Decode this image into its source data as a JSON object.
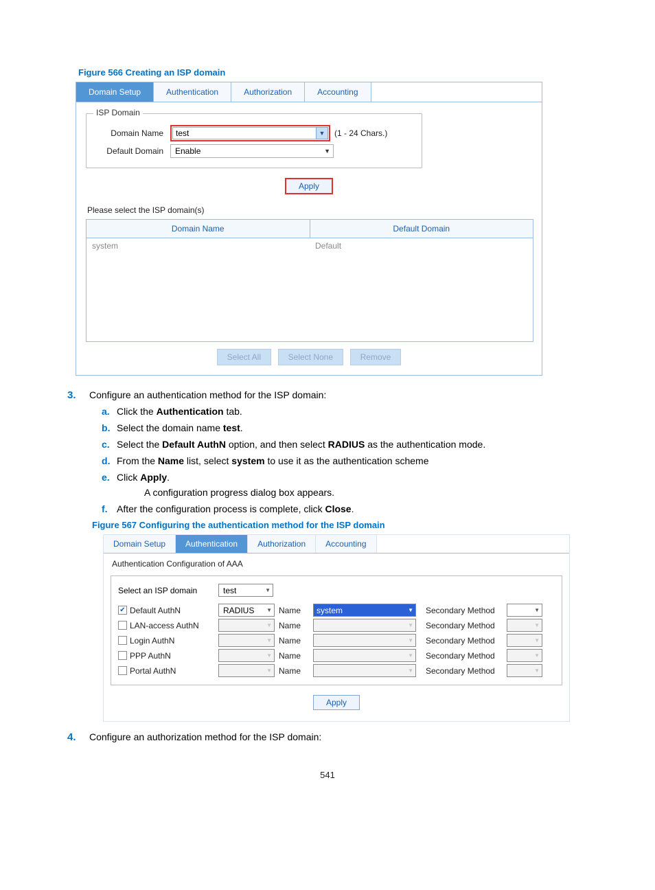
{
  "figure566": {
    "caption": "Figure 566 Creating an ISP domain",
    "tabs": [
      "Domain Setup",
      "Authentication",
      "Authorization",
      "Accounting"
    ],
    "active_tab": 0,
    "fieldset_title": "ISP Domain",
    "domain_name_label": "Domain Name",
    "domain_name_value": "test",
    "domain_name_hint": "(1 - 24 Chars.)",
    "default_domain_label": "Default Domain",
    "default_domain_value": "Enable",
    "apply": "Apply",
    "select_prompt": "Please select the ISP domain(s)",
    "table_headers": [
      "Domain Name",
      "Default Domain"
    ],
    "table_rows": [
      {
        "name": "system",
        "default": "Default"
      }
    ],
    "buttons": [
      "Select All",
      "Select None",
      "Remove"
    ]
  },
  "step3": {
    "lead": "Configure an authentication method for the ISP domain:",
    "a": "Click the ",
    "a_bold": "Authentication",
    "a_tail": " tab.",
    "b": "Select the domain name ",
    "b_bold": "test",
    "b_tail": ".",
    "c_pre": "Select the ",
    "c_b1": "Default AuthN",
    "c_mid": " option, and then select ",
    "c_b2": "RADIUS",
    "c_tail": " as the authentication mode.",
    "d_pre": "From the ",
    "d_b1": "Name",
    "d_mid": " list, select ",
    "d_b2": "system",
    "d_tail": " to use it as the authentication scheme",
    "e": "Click ",
    "e_bold": "Apply",
    "e_tail": ".",
    "e_note": "A configuration progress dialog box appears.",
    "f": "After the configuration process is complete, click ",
    "f_bold": "Close",
    "f_tail": "."
  },
  "figure567": {
    "caption": "Figure 567 Configuring the authentication method for the ISP domain",
    "tabs": [
      "Domain Setup",
      "Authentication",
      "Authorization",
      "Accounting"
    ],
    "active_tab": 1,
    "section_title": "Authentication Configuration of AAA",
    "select_domain_label": "Select an ISP domain",
    "select_domain_value": "test",
    "rows": [
      {
        "chk": true,
        "label": "Default AuthN",
        "method": "RADIUS",
        "name_label": "Name",
        "name_val": "system",
        "sec": "Secondary Method",
        "enabled": true
      },
      {
        "chk": false,
        "label": "LAN-access AuthN",
        "method": "",
        "name_label": "Name",
        "name_val": "",
        "sec": "Secondary Method",
        "enabled": false
      },
      {
        "chk": false,
        "label": "Login AuthN",
        "method": "",
        "name_label": "Name",
        "name_val": "",
        "sec": "Secondary Method",
        "enabled": false
      },
      {
        "chk": false,
        "label": "PPP AuthN",
        "method": "",
        "name_label": "Name",
        "name_val": "",
        "sec": "Secondary Method",
        "enabled": false
      },
      {
        "chk": false,
        "label": "Portal AuthN",
        "method": "",
        "name_label": "Name",
        "name_val": "",
        "sec": "Secondary Method",
        "enabled": false
      }
    ],
    "apply": "Apply"
  },
  "step4": {
    "lead": "Configure an authorization method for the ISP domain:"
  },
  "page_number": "541"
}
